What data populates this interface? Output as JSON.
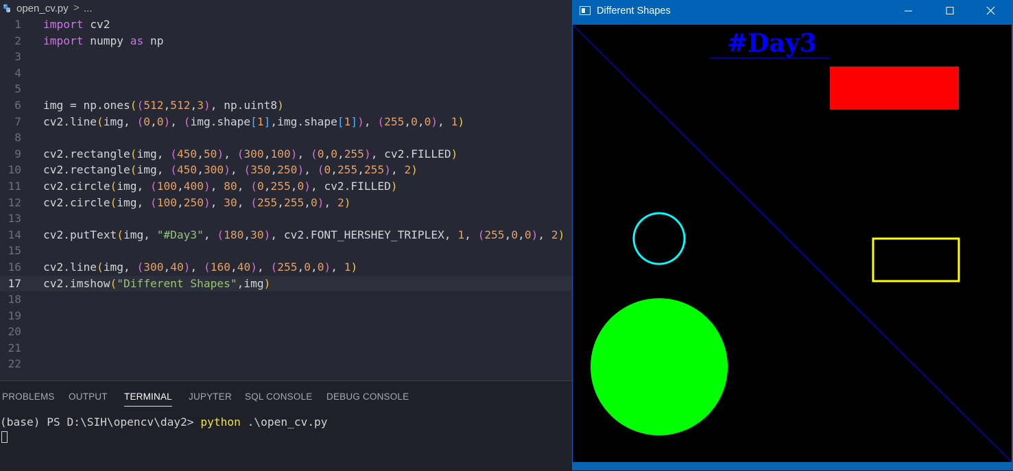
{
  "editor": {
    "breadcrumb": {
      "file": "open_cv.py",
      "separator": ">",
      "more": "..."
    },
    "lines": [
      {
        "n": "1",
        "code": "import cv2"
      },
      {
        "n": "2",
        "code": "import numpy as np"
      },
      {
        "n": "3",
        "code": ""
      },
      {
        "n": "4",
        "code": ""
      },
      {
        "n": "5",
        "code": ""
      },
      {
        "n": "6",
        "code": "img = np.ones((512,512,3), np.uint8)"
      },
      {
        "n": "7",
        "code": "cv2.line(img, (0,0), (img.shape[1],img.shape[1]), (255,0,0), 1)"
      },
      {
        "n": "8",
        "code": ""
      },
      {
        "n": "9",
        "code": "cv2.rectangle(img, (450,50), (300,100), (0,0,255), cv2.FILLED)"
      },
      {
        "n": "10",
        "code": "cv2.rectangle(img, (450,300), (350,250), (0,255,255), 2)"
      },
      {
        "n": "11",
        "code": "cv2.circle(img, (100,400), 80, (0,255,0), cv2.FILLED)"
      },
      {
        "n": "12",
        "code": "cv2.circle(img, (100,250), 30, (255,255,0), 2)"
      },
      {
        "n": "13",
        "code": ""
      },
      {
        "n": "14",
        "code": "cv2.putText(img, \"#Day3\", (180,30), cv2.FONT_HERSHEY_TRIPLEX, 1, (255,0,0), 2)"
      },
      {
        "n": "15",
        "code": ""
      },
      {
        "n": "16",
        "code": "cv2.line(img, (300,40), (160,40), (255,0,0), 1)"
      },
      {
        "n": "17",
        "code": "cv2.imshow(\"Different Shapes\",img)"
      },
      {
        "n": "18",
        "code": ""
      },
      {
        "n": "19",
        "code": ""
      },
      {
        "n": "20",
        "code": ""
      },
      {
        "n": "21",
        "code": ""
      },
      {
        "n": "22",
        "code": ""
      }
    ],
    "active_line": "17"
  },
  "panel": {
    "tabs": [
      "PROBLEMS",
      "OUTPUT",
      "TERMINAL",
      "JUPYTER",
      "SQL CONSOLE",
      "DEBUG CONSOLE"
    ],
    "active_tab": "TERMINAL",
    "terminal": {
      "prompt": "(base) PS D:\\SIH\\opencv\\day2> ",
      "command": "python",
      "args": " .\\open_cv.py"
    }
  },
  "window": {
    "title": "Different Shapes",
    "canvas_text": "#Day3",
    "colors": {
      "background": "#000000",
      "diagonal_line": "#0000ff",
      "text": "#0000ff",
      "underline": "#0000ff",
      "filled_rectangle": "#ff0000",
      "outline_rectangle": "#ffff00",
      "filled_circle": "#00ff00",
      "outline_circle": "#00ffff"
    }
  },
  "colors": {
    "editor_bg": "#262833",
    "panel_bg": "#1f2029",
    "titlebar": "#0062b5"
  }
}
